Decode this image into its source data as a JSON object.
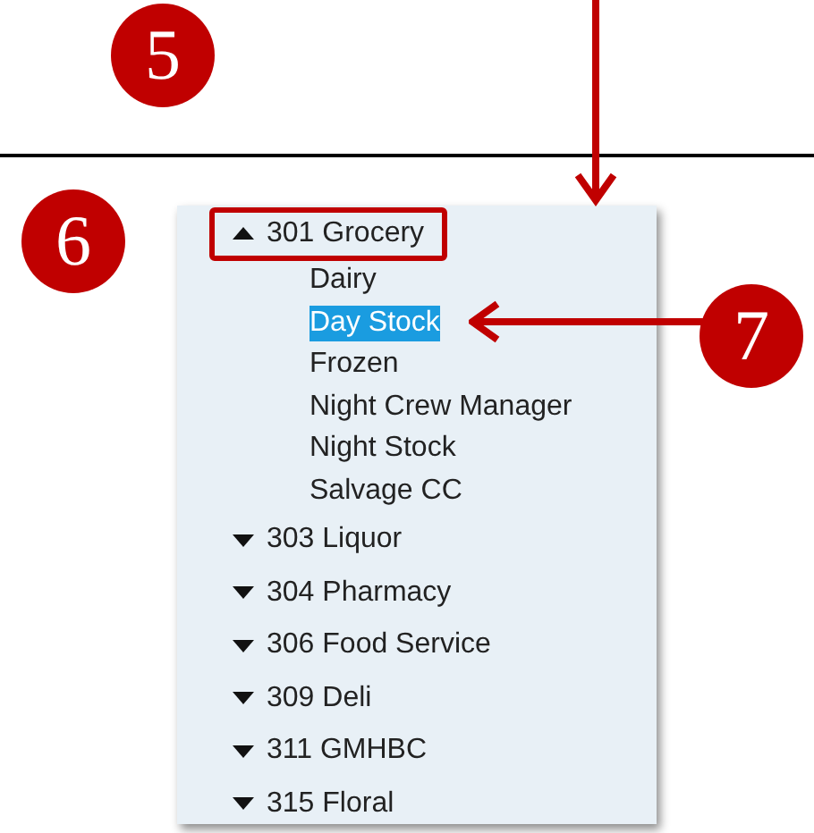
{
  "step_badges": [
    {
      "label": "5"
    },
    {
      "label": "6"
    },
    {
      "label": "7"
    }
  ],
  "tree": [
    {
      "label": "301 Grocery",
      "expanded": true,
      "outlined": true,
      "children": [
        {
          "label": "Dairy",
          "selected": false
        },
        {
          "label": "Day Stock",
          "selected": true
        },
        {
          "label": "Frozen",
          "selected": false
        },
        {
          "label": "Night Crew Manager",
          "selected": false
        },
        {
          "label": "Night Stock",
          "selected": false
        },
        {
          "label": "Salvage CC",
          "selected": false
        }
      ]
    },
    {
      "label": "303 Liquor",
      "expanded": false,
      "outlined": false
    },
    {
      "label": "304 Pharmacy",
      "expanded": false,
      "outlined": false
    },
    {
      "label": "306 Food Service",
      "expanded": false,
      "outlined": false
    },
    {
      "label": "309 Deli",
      "expanded": false,
      "outlined": false
    },
    {
      "label": "311 GMHBC",
      "expanded": false,
      "outlined": false
    },
    {
      "label": "315 Floral",
      "expanded": false,
      "outlined": false
    }
  ]
}
